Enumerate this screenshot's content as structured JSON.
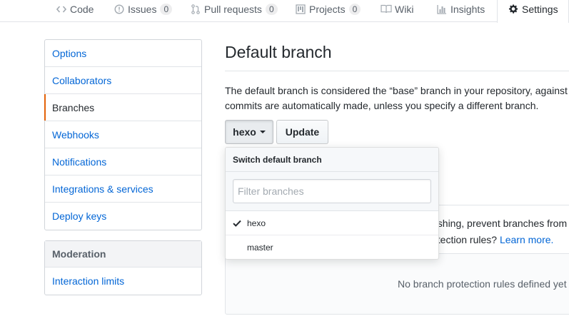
{
  "reponav": {
    "tabs": [
      {
        "label": "Code",
        "icon": "code-icon"
      },
      {
        "label": "Issues",
        "icon": "issue-icon",
        "count": "0"
      },
      {
        "label": "Pull requests",
        "icon": "pull-request-icon",
        "count": "0"
      },
      {
        "label": "Projects",
        "icon": "project-icon",
        "count": "0"
      },
      {
        "label": "Wiki",
        "icon": "book-icon"
      },
      {
        "label": "Insights",
        "icon": "graph-icon"
      },
      {
        "label": "Settings",
        "icon": "gear-icon",
        "selected": true
      }
    ]
  },
  "sidebar": {
    "items": [
      {
        "label": "Options"
      },
      {
        "label": "Collaborators"
      },
      {
        "label": "Branches",
        "selected": true
      },
      {
        "label": "Webhooks"
      },
      {
        "label": "Notifications"
      },
      {
        "label": "Integrations & services"
      },
      {
        "label": "Deploy keys"
      }
    ],
    "moderation": {
      "heading": "Moderation",
      "items": [
        {
          "label": "Interaction limits"
        }
      ]
    }
  },
  "main": {
    "title": "Default branch",
    "description_line1": "The default branch is considered the “base” branch in your repository, against",
    "description_line2": "commits are automatically made, unless you specify a different branch.",
    "branch_button": "hexo",
    "update_button": "Update",
    "protection_line1": "ushing, prevent branches from",
    "protection_line2_prefix": "otection rules? ",
    "protection_link": "Learn more.",
    "blankslate": "No branch protection rules defined yet"
  },
  "dropdown": {
    "header": "Switch default branch",
    "filter_placeholder": "Filter branches",
    "filter_value": "",
    "branches": [
      {
        "name": "hexo",
        "selected": true
      },
      {
        "name": "master",
        "selected": false
      }
    ]
  },
  "colors": {
    "link": "#0366d6",
    "selected_accent": "#e36209",
    "text": "#24292e",
    "muted": "#586069"
  }
}
